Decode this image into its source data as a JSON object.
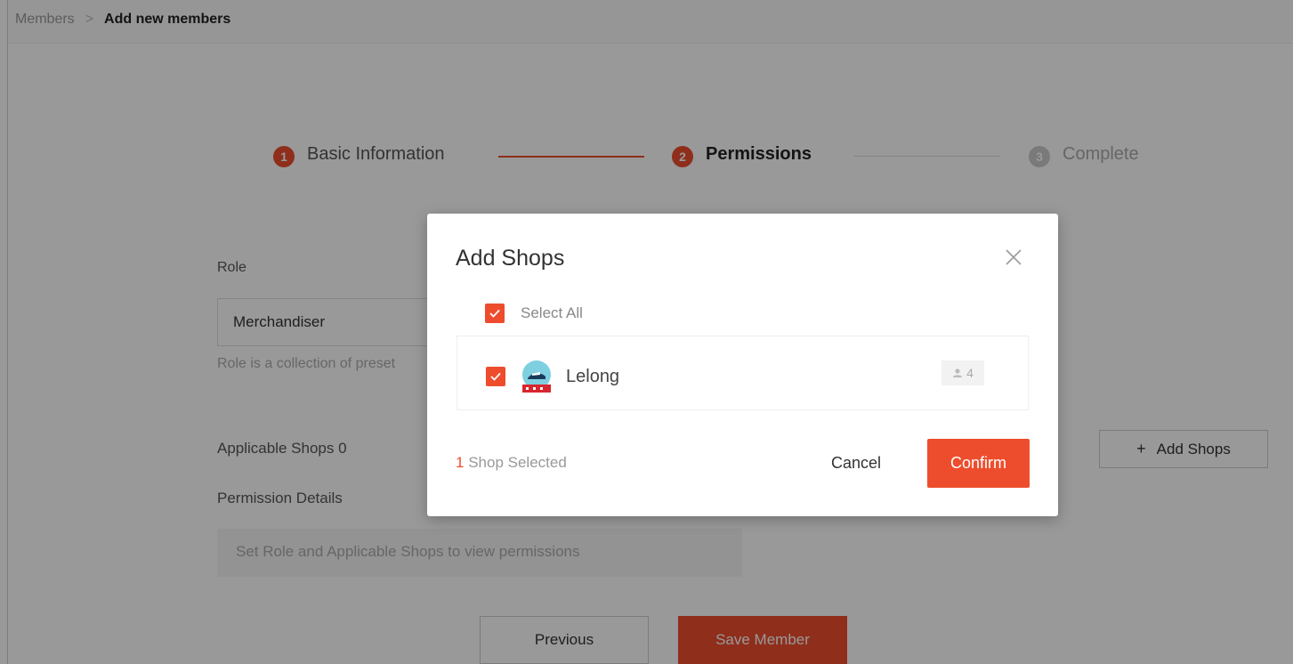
{
  "breadcrumb": {
    "parent": "Members",
    "separator": ">",
    "current": "Add new members"
  },
  "steps": [
    {
      "number": "1",
      "label": "Basic Information",
      "state": "done"
    },
    {
      "number": "2",
      "label": "Permissions",
      "state": "active"
    },
    {
      "number": "3",
      "label": "Complete",
      "state": "pending"
    }
  ],
  "form": {
    "role_label": "Role",
    "role_value": "Merchandiser",
    "role_help": "Role is a collection of preset",
    "applicable_shops_label": "Applicable Shops 0",
    "add_shops_label": "Add Shops",
    "permission_details_label": "Permission Details",
    "permission_placeholder": "Set Role and Applicable Shops to view permissions",
    "previous_label": "Previous",
    "save_label": "Save Member"
  },
  "modal": {
    "title": "Add Shops",
    "select_all_label": "Select All",
    "select_all_checked": true,
    "shops": [
      {
        "name": "Lelong",
        "checked": true,
        "member_count": "4",
        "icon": "shop-logo"
      }
    ],
    "selected_count": "1",
    "selected_suffix": "Shop Selected",
    "cancel_label": "Cancel",
    "confirm_label": "Confirm"
  },
  "colors": {
    "accent": "#ee4d2d",
    "overlay": "rgba(0,0,0,0.4)"
  }
}
